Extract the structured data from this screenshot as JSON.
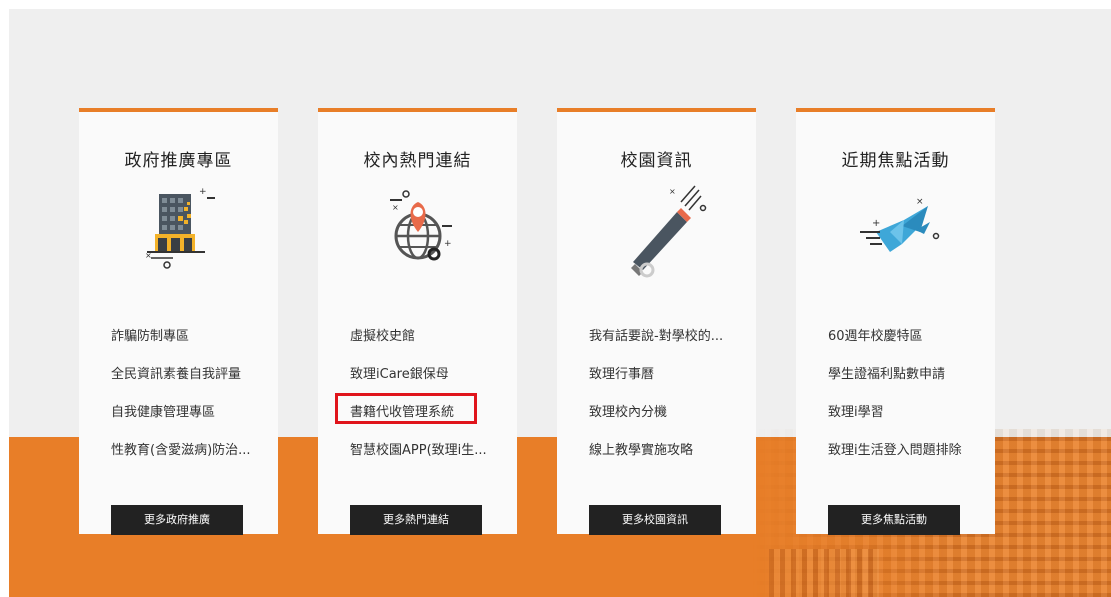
{
  "cards": [
    {
      "title": "政府推廣專區",
      "icon": "office-building-icon",
      "links": [
        "詐騙防制專區",
        "全民資訊素養自我評量",
        "自我健康管理專區",
        "性教育(含愛滋病)防治..."
      ],
      "more_label": "更多政府推廣"
    },
    {
      "title": "校內熱門連結",
      "icon": "globe-location-pin-icon",
      "links": [
        "虛擬校史館",
        "致理iCare銀保母",
        "書籍代收管理系統",
        "智慧校園APP(致理i生..."
      ],
      "more_label": "更多熱門連結",
      "highlighted_link": "書籍代收管理系統"
    },
    {
      "title": "校園資訊",
      "icon": "megaphone-icon",
      "links": [
        "我有話要說-對學校的...",
        "致理行事曆",
        "致理校內分機",
        "線上教學實施攻略"
      ],
      "more_label": "更多校園資訊"
    },
    {
      "title": "近期焦點活動",
      "icon": "bird-icon",
      "links": [
        "60週年校慶特區",
        "學生證福利點數申請",
        "致理i學習",
        "致理i生活登入問題排除"
      ],
      "more_label": "更多焦點活動"
    }
  ],
  "colors": {
    "accent": "#e87e28",
    "background": "#efefef",
    "card": "#fafafa",
    "button": "#222222",
    "highlight": "#e0141b"
  }
}
